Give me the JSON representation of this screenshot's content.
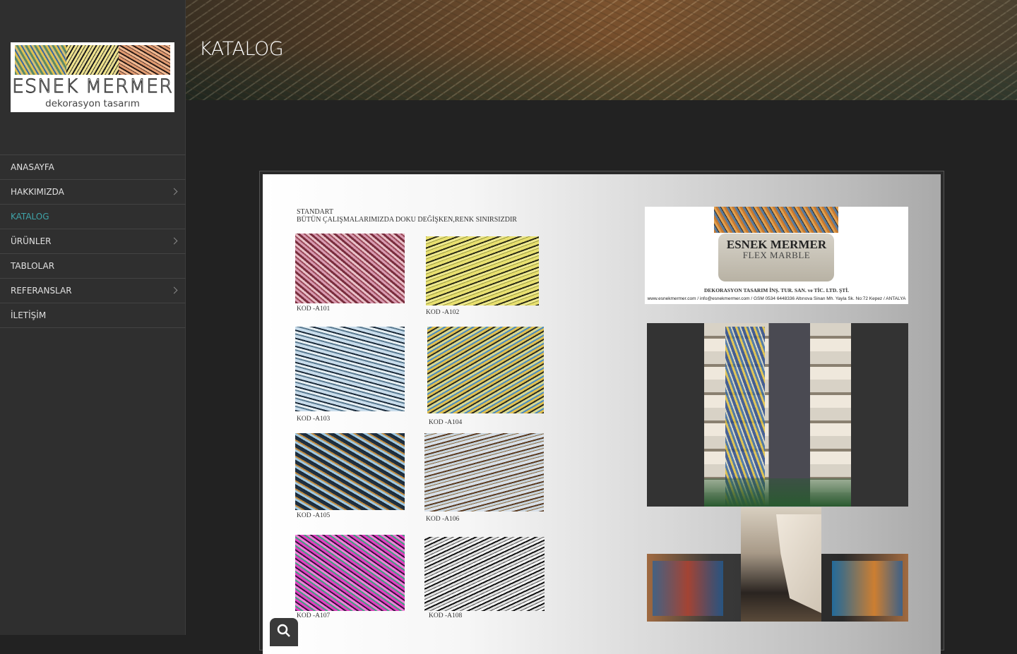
{
  "logo": {
    "title": "ESNEK MERMER",
    "subtitle": "dekorasyon tasarım"
  },
  "nav": {
    "items": [
      {
        "label": "ANASAYFA",
        "has_submenu": false,
        "active": false
      },
      {
        "label": "HAKKIMIZDA",
        "has_submenu": true,
        "active": false
      },
      {
        "label": "KATALOG",
        "has_submenu": false,
        "active": true
      },
      {
        "label": "ÜRÜNLER",
        "has_submenu": true,
        "active": false
      },
      {
        "label": "TABLOLAR",
        "has_submenu": false,
        "active": false
      },
      {
        "label": "REFERANSLAR",
        "has_submenu": true,
        "active": false
      },
      {
        "label": "İLETİŞİM",
        "has_submenu": false,
        "active": false
      }
    ],
    "active_color": "#3fa3a8"
  },
  "header": {
    "page_title": "KATALOG"
  },
  "catalog": {
    "heading_line1": "STANDART",
    "heading_line2": "BÜTÜN ÇALIŞMALARIMIZDA DOKU DEĞİŞKEN,RENK SINIRSIZDIR",
    "swatches": [
      {
        "code": "KOD -A101"
      },
      {
        "code": "KOD -A102"
      },
      {
        "code": "KOD -A103"
      },
      {
        "code": "KOD -A104"
      },
      {
        "code": "KOD -A105"
      },
      {
        "code": "KOD -A106"
      },
      {
        "code": "KOD -A107"
      },
      {
        "code": "KOD -A108"
      }
    ],
    "brand": {
      "name": "ESNEK MERMER",
      "tagline": "FLEX MARBLE",
      "company": "DEKORASYON TASARIM İNŞ. TUR. SAN. ve TİC. LTD. ŞTİ.",
      "contact": "www.esnekmermer.com / info@esnekmermer.com / GSM 0534 6448336 Altınova Sinan Mh. Yayla Sk. No:72 Kepez / ANTALYA"
    }
  },
  "icons": {
    "search": "search-icon",
    "chevron": "chevron-right-icon"
  }
}
